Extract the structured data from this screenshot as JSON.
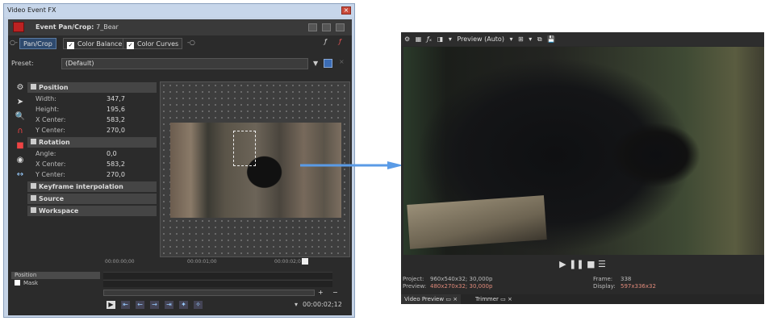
{
  "window": {
    "title": "Video Event FX",
    "close": "×"
  },
  "header": {
    "title": "Event Pan/Crop:",
    "event": "7_Bear"
  },
  "chain": {
    "items": [
      "Pan/Crop",
      "Color Balance",
      "Color Curves"
    ]
  },
  "preset": {
    "label": "Preset:",
    "value": "(Default)"
  },
  "position": {
    "section": "Position",
    "width_label": "Width:",
    "width": "347,7",
    "height_label": "Height:",
    "height": "195,6",
    "xcenter_label": "X Center:",
    "xcenter": "583,2",
    "ycenter_label": "Y Center:",
    "ycenter": "270,0"
  },
  "rotation": {
    "section": "Rotation",
    "angle_label": "Angle:",
    "angle": "0,0",
    "xcenter_label": "X Center:",
    "xcenter": "583,2",
    "ycenter_label": "Y Center:",
    "ycenter": "270,0"
  },
  "sections": {
    "keyframe": "Keyframe interpolation",
    "source": "Source",
    "workspace": "Workspace"
  },
  "timeline": {
    "ticks": [
      "00:00:00;00",
      "00:00:01;00",
      "00:00:02;0"
    ],
    "tracks": [
      "Position",
      "Mask"
    ],
    "time": "00:00:02;12"
  },
  "preview": {
    "quality": "Preview (Auto)",
    "project_label": "Project:",
    "project": "960x540x32; 30,000p",
    "preview_label": "Preview:",
    "preview": "480x270x32; 30,000p",
    "frame_label": "Frame:",
    "frame": "338",
    "display_label": "Display:",
    "display": "597x336x32",
    "tabs": [
      "Video Preview",
      "Trimmer"
    ]
  },
  "colors": {
    "accent_arrow": "#5a9be6",
    "preview_red": "#e08a7a"
  }
}
